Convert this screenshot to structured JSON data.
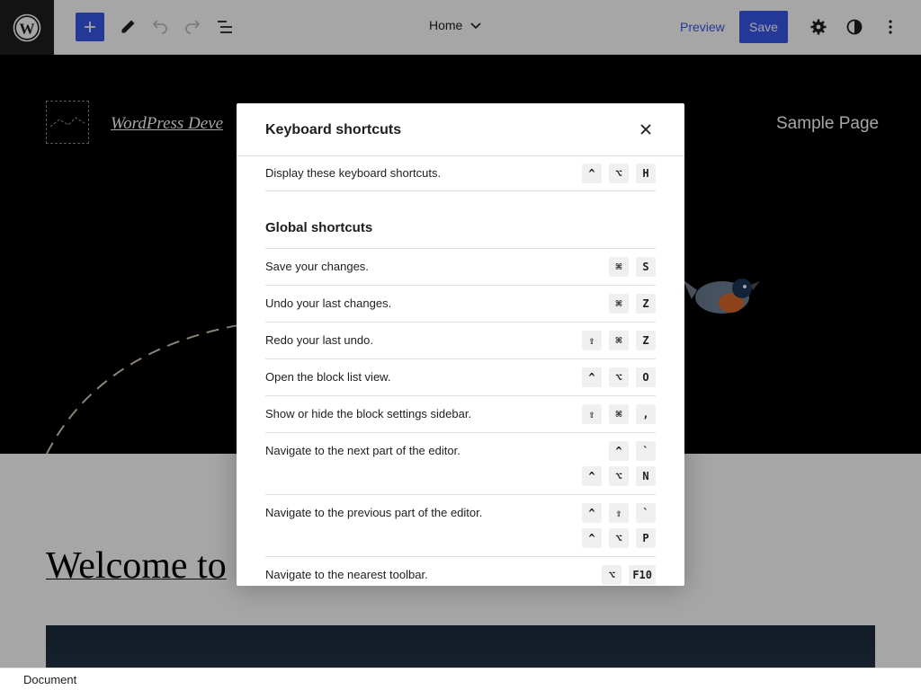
{
  "toolbar": {
    "document_title": "Home",
    "preview_label": "Preview",
    "save_label": "Save",
    "icons": [
      "wordpress-logo-icon",
      "plus-icon",
      "pencil-icon",
      "undo-icon",
      "redo-icon",
      "list-view-icon",
      "chevron-down-icon",
      "gear-icon",
      "contrast-icon",
      "more-vertical-icon"
    ]
  },
  "site": {
    "title": "WordPress Deve",
    "nav_link": "Sample Page",
    "welcome_heading": "Welcome to"
  },
  "statusbar": {
    "breadcrumb": "Document"
  },
  "modal": {
    "title": "Keyboard shortcuts",
    "intro": {
      "description": "Display these keyboard shortcuts.",
      "keys": [
        [
          "^",
          "⌥",
          "H"
        ]
      ]
    },
    "section_title": "Global shortcuts",
    "shortcuts": [
      {
        "description": "Save your changes.",
        "keys": [
          [
            "⌘",
            "S"
          ]
        ]
      },
      {
        "description": "Undo your last changes.",
        "keys": [
          [
            "⌘",
            "Z"
          ]
        ]
      },
      {
        "description": "Redo your last undo.",
        "keys": [
          [
            "⇧",
            "⌘",
            "Z"
          ]
        ]
      },
      {
        "description": "Open the block list view.",
        "keys": [
          [
            "^",
            "⌥",
            "O"
          ]
        ]
      },
      {
        "description": "Show or hide the block settings sidebar.",
        "keys": [
          [
            "⇧",
            "⌘",
            ","
          ]
        ]
      },
      {
        "description": "Navigate to the next part of the editor.",
        "keys": [
          [
            "^",
            "`"
          ],
          [
            "^",
            "⌥",
            "N"
          ]
        ]
      },
      {
        "description": "Navigate to the previous part of the editor.",
        "keys": [
          [
            "^",
            "⇧",
            "`"
          ],
          [
            "^",
            "⌥",
            "P"
          ]
        ]
      },
      {
        "description": "Navigate to the nearest toolbar.",
        "keys": [
          [
            "⌥",
            "F10"
          ]
        ]
      }
    ]
  },
  "colors": {
    "accent": "#3858e9",
    "dark": "#1e1e1e",
    "hero_bg": "#000000",
    "key_bg": "#f0f0f0"
  }
}
